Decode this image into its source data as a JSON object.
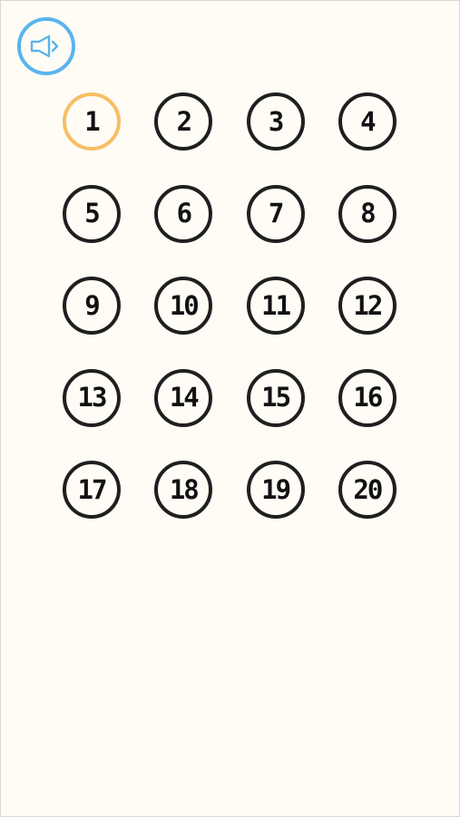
{
  "colors": {
    "background": "#fefcf5",
    "sound_accent": "#5ab4ee",
    "current_level_ring": "#f7be62",
    "level_ring": "#1f1f1f",
    "level_text": "#111111"
  },
  "sound_button": {
    "icon": "speaker-icon",
    "state": "on"
  },
  "level_select": {
    "current_level": 1,
    "levels": [
      {
        "label": "1"
      },
      {
        "label": "2"
      },
      {
        "label": "3"
      },
      {
        "label": "4"
      },
      {
        "label": "5"
      },
      {
        "label": "6"
      },
      {
        "label": "7"
      },
      {
        "label": "8"
      },
      {
        "label": "9"
      },
      {
        "label": "10"
      },
      {
        "label": "11"
      },
      {
        "label": "12"
      },
      {
        "label": "13"
      },
      {
        "label": "14"
      },
      {
        "label": "15"
      },
      {
        "label": "16"
      },
      {
        "label": "17"
      },
      {
        "label": "18"
      },
      {
        "label": "19"
      },
      {
        "label": "20"
      }
    ]
  }
}
